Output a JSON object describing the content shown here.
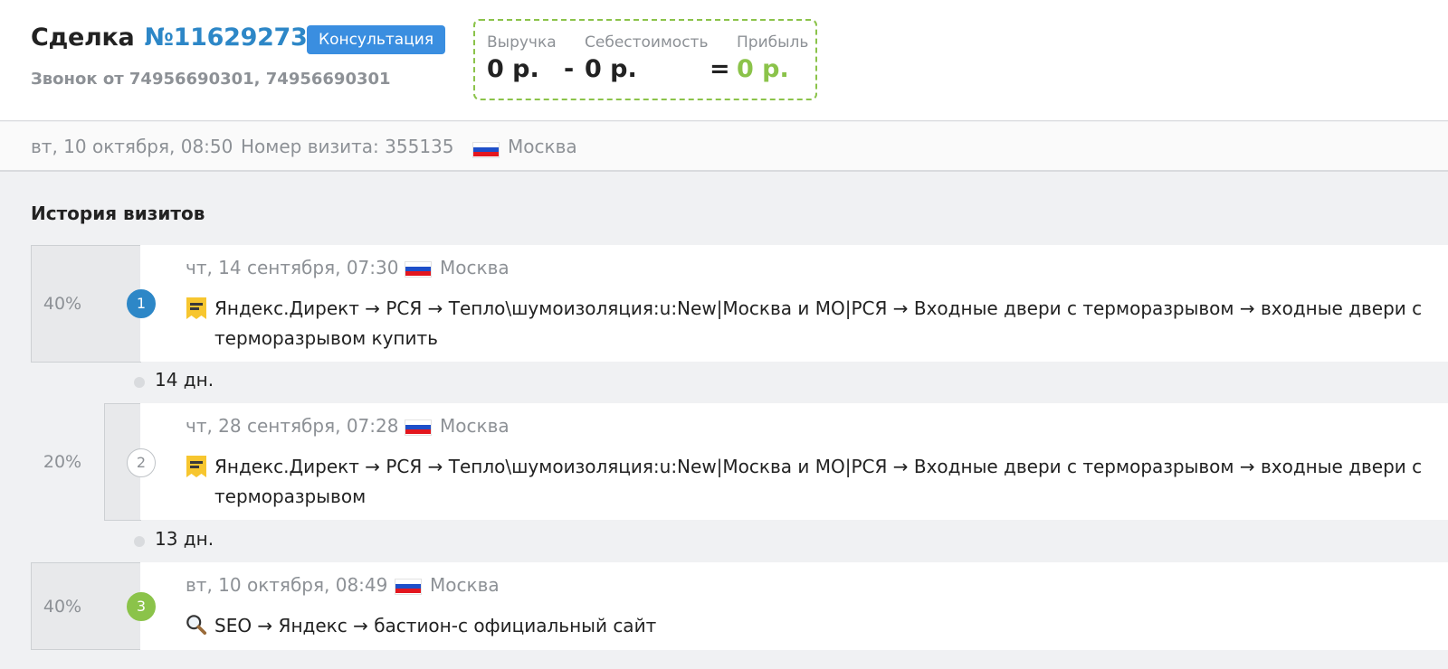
{
  "deal": {
    "title_prefix": "Сделка",
    "number": "№11629273",
    "status_badge": "Консультация",
    "call_info": "Звонок от 74956690301, 74956690301"
  },
  "finance": {
    "revenue_label": "Выручка",
    "revenue_value": "0 р.",
    "minus": "-",
    "cost_label": "Себестоимость",
    "cost_value": "0 р.",
    "equals": "=",
    "profit_label": "Прибыль",
    "profit_value": "0 р.",
    "profit_color": "#8bc34a"
  },
  "info": {
    "date": "вт, 10 октября, 08:50",
    "visit_number": "Номер визита: 355135",
    "city": "Москва",
    "flag_icon": "russia-flag-icon"
  },
  "history": {
    "title": "История визитов",
    "visits": [
      {
        "index": "1",
        "percent": "40%",
        "date": "чт, 14 сентября, 07:30",
        "city": "Москва",
        "source_icon": "yandex-direct-icon",
        "path": "Яндекс.Директ → РСЯ → Тепло\\шумоизоляция:u:New|Москва и МО|РСЯ → Входные двери с терморазрывом → входные двери с терморазрывом купить",
        "marker_color": "#2d87c7"
      },
      {
        "index": "2",
        "percent": "20%",
        "date": "чт, 28 сентября, 07:28",
        "city": "Москва",
        "source_icon": "yandex-direct-icon",
        "path": "Яндекс.Директ → РСЯ → Тепло\\шумоизоляция:u:New|Москва и МО|РСЯ → Входные двери с терморазрывом → входные двери с терморазрывом",
        "marker_color": "#ffffff"
      },
      {
        "index": "3",
        "percent": "40%",
        "date": "вт, 10 октября, 08:49",
        "city": "Москва",
        "source_icon": "search-icon",
        "path": "SEO → Яндекс → бастион-с официальный сайт",
        "marker_color": "#8bc34a"
      }
    ],
    "gaps": [
      "14 дн.",
      "13 дн."
    ]
  }
}
